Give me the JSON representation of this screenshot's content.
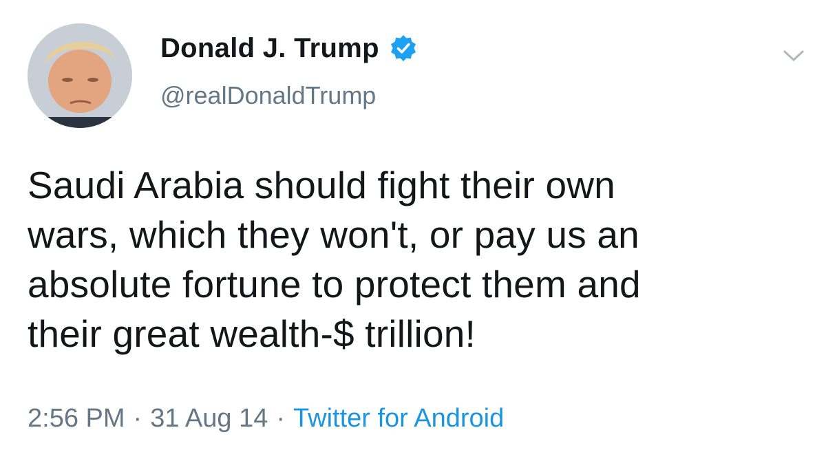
{
  "author": {
    "display_name": "Donald J. Trump",
    "handle": "@realDonaldTrump",
    "verified": true
  },
  "tweet": {
    "text_lines": [
      "Saudi Arabia should fight their own",
      "wars, which they won't, or pay us an",
      "absolute fortune to protect them and",
      "their great wealth-$ trillion!"
    ]
  },
  "meta": {
    "time": "2:56 PM",
    "separator": "·",
    "date": "31 Aug 14",
    "source": "Twitter for Android"
  },
  "icons": {
    "verified": "verified-badge-icon",
    "menu": "chevron-down-icon"
  },
  "colors": {
    "text": "#14171a",
    "secondary": "#657786",
    "link": "#1b95e0",
    "verified": "#1da1f2"
  }
}
